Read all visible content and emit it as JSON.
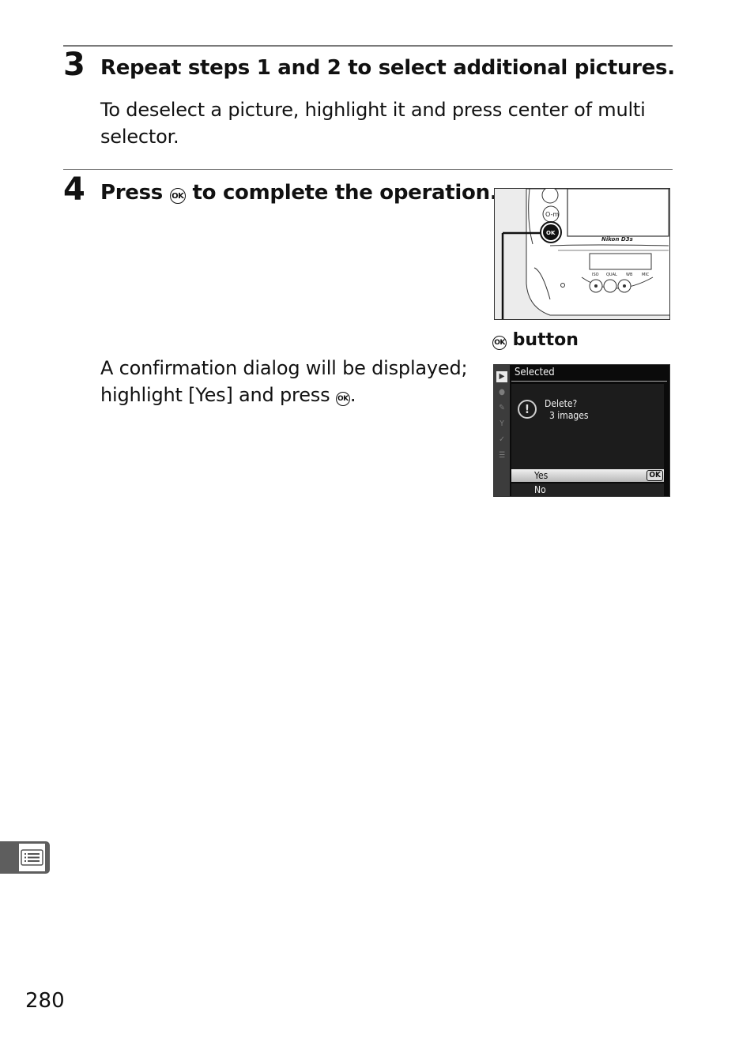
{
  "steps": [
    {
      "number": "3",
      "title": "Repeat steps 1 and 2 to select additional pictures.",
      "body_lines": [
        "To deselect a picture, highlight it and press center of multi",
        "selector."
      ]
    },
    {
      "number": "4",
      "title_before": "Press",
      "title_icon": "ok-button-icon",
      "title_after": "to complete the operation.",
      "body_lines": [
        "A confirmation dialog will be displayed;",
        "highlight [Yes] and press"
      ],
      "body_end": "."
    }
  ],
  "icons": {
    "ok_glyph": "OK"
  },
  "camera_figure": {
    "callout_label": "button",
    "ok_button_text": "OK",
    "brand_text": "Nikon D3s",
    "control_labels": [
      "ISO",
      "QUAL",
      "WB",
      "MIC"
    ]
  },
  "lcd_dialog": {
    "title": "Selected",
    "message_line1": "Delete?",
    "message_line2": "3  images",
    "options": [
      {
        "label": "Yes",
        "highlighted": true,
        "badge": "OK"
      },
      {
        "label": "No",
        "highlighted": false
      }
    ],
    "sidebar_tabs": [
      "playback-icon",
      "camera-icon",
      "pencil-icon",
      "wrench-icon",
      "retouch-icon",
      "my-menu-icon"
    ]
  },
  "side_tab": {
    "icon": "menu-list-icon"
  },
  "page_number": "280"
}
